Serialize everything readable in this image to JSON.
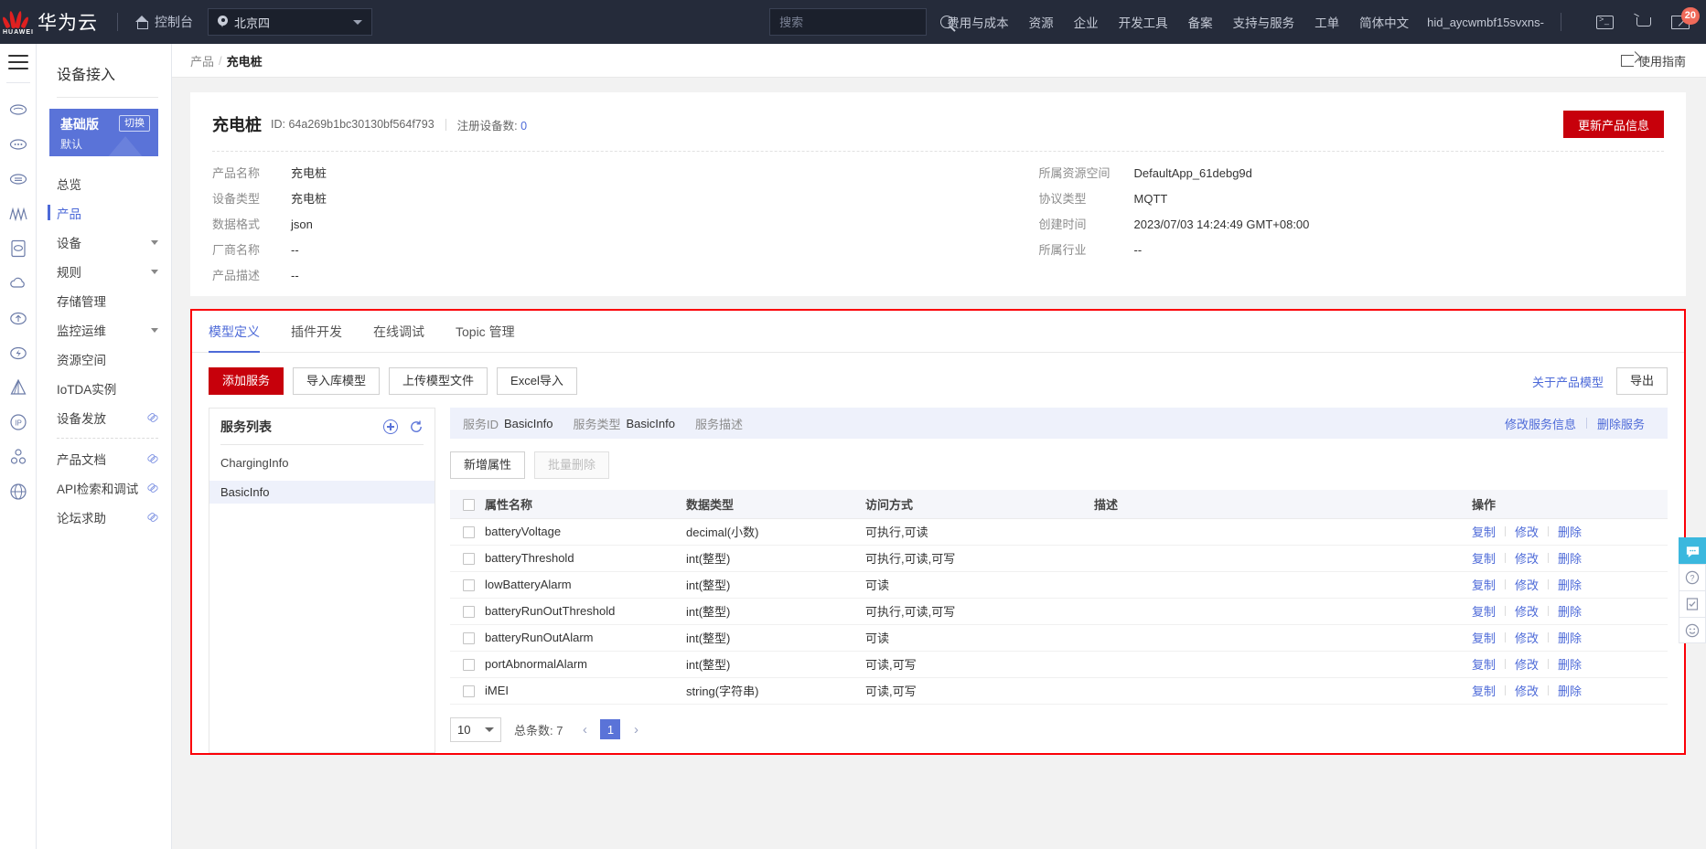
{
  "topbar": {
    "brand": "华为云",
    "brand_mark": "HUAWEI",
    "console": "控制台",
    "region": "北京四",
    "search_placeholder": "搜索",
    "nav": [
      "费用与成本",
      "资源",
      "企业",
      "开发工具",
      "备案",
      "支持与服务",
      "工单",
      "简体中文"
    ],
    "user": "hid_aycwmbf15svxns-",
    "message_badge": "20",
    "icons": [
      "terminal-icon",
      "cart-icon",
      "mail-icon"
    ]
  },
  "sidebar": {
    "title": "设备接入",
    "edition": {
      "name": "基础版",
      "switch_label": "切换",
      "sub": "默认"
    },
    "items": [
      {
        "label": "总览",
        "type": "plain",
        "active": false
      },
      {
        "label": "产品",
        "type": "plain",
        "active": true
      },
      {
        "label": "设备",
        "type": "expand",
        "active": false
      },
      {
        "label": "规则",
        "type": "expand",
        "active": false
      },
      {
        "label": "存储管理",
        "type": "plain",
        "active": false
      },
      {
        "label": "监控运维",
        "type": "expand",
        "active": false
      },
      {
        "label": "资源空间",
        "type": "plain",
        "active": false
      },
      {
        "label": "IoTDA实例",
        "type": "plain",
        "active": false
      },
      {
        "label": "设备发放",
        "type": "external",
        "active": false
      },
      {
        "label": "产品文档",
        "type": "external",
        "active": false
      },
      {
        "label": "API检索和调试",
        "type": "external",
        "active": false
      },
      {
        "label": "论坛求助",
        "type": "external",
        "active": false
      }
    ]
  },
  "breadcrumb": {
    "parent": "产品",
    "separator": "/",
    "current": "充电桩",
    "guide": "使用指南"
  },
  "product": {
    "title": "充电桩",
    "id_label": "ID:",
    "id_value": "64a269b1bc30130bf564f793",
    "registered_label": "注册设备数:",
    "registered_value": "0",
    "update_button": "更新产品信息",
    "left_fields": [
      {
        "label": "产品名称",
        "value": "充电桩"
      },
      {
        "label": "设备类型",
        "value": "充电桩"
      },
      {
        "label": "数据格式",
        "value": "json"
      },
      {
        "label": "厂商名称",
        "value": "--"
      },
      {
        "label": "产品描述",
        "value": "--"
      }
    ],
    "right_fields": [
      {
        "label": "所属资源空间",
        "value": "DefaultApp_61debg9d"
      },
      {
        "label": "协议类型",
        "value": "MQTT"
      },
      {
        "label": "创建时间",
        "value": "2023/07/03 14:24:49 GMT+08:00"
      },
      {
        "label": "所属行业",
        "value": "--"
      }
    ]
  },
  "tabs": [
    {
      "label": "模型定义",
      "active": true
    },
    {
      "label": "插件开发",
      "active": false
    },
    {
      "label": "在线调试",
      "active": false
    },
    {
      "label": "Topic 管理",
      "active": false
    }
  ],
  "toolbar": {
    "add_service": "添加服务",
    "import_lib": "导入库模型",
    "upload_model": "上传模型文件",
    "excel_import": "Excel导入",
    "about_model": "关于产品模型",
    "export": "导出"
  },
  "service_list": {
    "title": "服务列表",
    "add_icon": "plus-circle-icon",
    "refresh_icon": "refresh-icon",
    "items": [
      {
        "name": "ChargingInfo",
        "selected": false
      },
      {
        "name": "BasicInfo",
        "selected": true
      }
    ]
  },
  "service_detail": {
    "id_label": "服务ID",
    "id_value": "BasicInfo",
    "type_label": "服务类型",
    "type_value": "BasicInfo",
    "desc_label": "服务描述",
    "desc_value": "",
    "edit_link": "修改服务信息",
    "delete_link": "删除服务"
  },
  "property_toolbar": {
    "add": "新增属性",
    "batch_delete": "批量删除"
  },
  "table": {
    "headers": [
      "属性名称",
      "数据类型",
      "访问方式",
      "描述",
      "操作"
    ],
    "ops": [
      "复制",
      "修改",
      "删除"
    ],
    "rows": [
      {
        "name": "batteryVoltage",
        "type": "decimal(小数)",
        "access": "可执行,可读",
        "desc": ""
      },
      {
        "name": "batteryThreshold",
        "type": "int(整型)",
        "access": "可执行,可读,可写",
        "desc": ""
      },
      {
        "name": "lowBatteryAlarm",
        "type": "int(整型)",
        "access": "可读",
        "desc": ""
      },
      {
        "name": "batteryRunOutThreshold",
        "type": "int(整型)",
        "access": "可执行,可读,可写",
        "desc": ""
      },
      {
        "name": "batteryRunOutAlarm",
        "type": "int(整型)",
        "access": "可读",
        "desc": ""
      },
      {
        "name": "portAbnormalAlarm",
        "type": "int(整型)",
        "access": "可读,可写",
        "desc": ""
      },
      {
        "name": "iMEI",
        "type": "string(字符串)",
        "access": "可读,可写",
        "desc": ""
      }
    ]
  },
  "pagination": {
    "page_size": "10",
    "total_label": "总条数:",
    "total_value": "7",
    "prev": "‹",
    "current_page": "1",
    "next": "›"
  },
  "colors": {
    "brand_red": "#c7000b",
    "accent_blue": "#4d6ad8",
    "highlight_border": "#fb0007",
    "header_bg": "#252b3a"
  }
}
